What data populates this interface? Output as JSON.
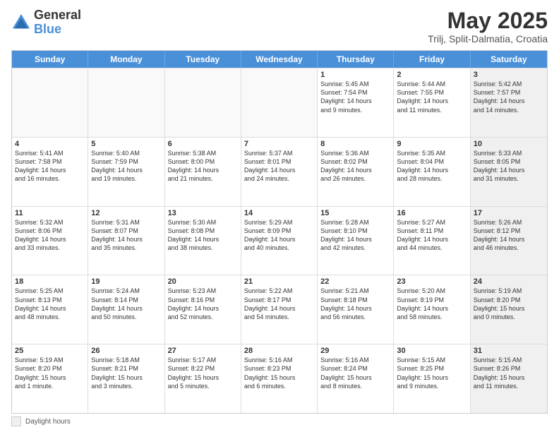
{
  "logo": {
    "general": "General",
    "blue": "Blue"
  },
  "title": "May 2025",
  "subtitle": "Trilj, Split-Dalmatia, Croatia",
  "weekdays": [
    "Sunday",
    "Monday",
    "Tuesday",
    "Wednesday",
    "Thursday",
    "Friday",
    "Saturday"
  ],
  "legend_label": "Daylight hours",
  "weeks": [
    [
      {
        "day": "",
        "text": "",
        "empty": true
      },
      {
        "day": "",
        "text": "",
        "empty": true
      },
      {
        "day": "",
        "text": "",
        "empty": true
      },
      {
        "day": "",
        "text": "",
        "empty": true
      },
      {
        "day": "1",
        "text": "Sunrise: 5:45 AM\nSunset: 7:54 PM\nDaylight: 14 hours\nand 9 minutes."
      },
      {
        "day": "2",
        "text": "Sunrise: 5:44 AM\nSunset: 7:55 PM\nDaylight: 14 hours\nand 11 minutes."
      },
      {
        "day": "3",
        "text": "Sunrise: 5:42 AM\nSunset: 7:57 PM\nDaylight: 14 hours\nand 14 minutes.",
        "shaded": true
      }
    ],
    [
      {
        "day": "4",
        "text": "Sunrise: 5:41 AM\nSunset: 7:58 PM\nDaylight: 14 hours\nand 16 minutes."
      },
      {
        "day": "5",
        "text": "Sunrise: 5:40 AM\nSunset: 7:59 PM\nDaylight: 14 hours\nand 19 minutes."
      },
      {
        "day": "6",
        "text": "Sunrise: 5:38 AM\nSunset: 8:00 PM\nDaylight: 14 hours\nand 21 minutes."
      },
      {
        "day": "7",
        "text": "Sunrise: 5:37 AM\nSunset: 8:01 PM\nDaylight: 14 hours\nand 24 minutes."
      },
      {
        "day": "8",
        "text": "Sunrise: 5:36 AM\nSunset: 8:02 PM\nDaylight: 14 hours\nand 26 minutes."
      },
      {
        "day": "9",
        "text": "Sunrise: 5:35 AM\nSunset: 8:04 PM\nDaylight: 14 hours\nand 28 minutes."
      },
      {
        "day": "10",
        "text": "Sunrise: 5:33 AM\nSunset: 8:05 PM\nDaylight: 14 hours\nand 31 minutes.",
        "shaded": true
      }
    ],
    [
      {
        "day": "11",
        "text": "Sunrise: 5:32 AM\nSunset: 8:06 PM\nDaylight: 14 hours\nand 33 minutes."
      },
      {
        "day": "12",
        "text": "Sunrise: 5:31 AM\nSunset: 8:07 PM\nDaylight: 14 hours\nand 35 minutes."
      },
      {
        "day": "13",
        "text": "Sunrise: 5:30 AM\nSunset: 8:08 PM\nDaylight: 14 hours\nand 38 minutes."
      },
      {
        "day": "14",
        "text": "Sunrise: 5:29 AM\nSunset: 8:09 PM\nDaylight: 14 hours\nand 40 minutes."
      },
      {
        "day": "15",
        "text": "Sunrise: 5:28 AM\nSunset: 8:10 PM\nDaylight: 14 hours\nand 42 minutes."
      },
      {
        "day": "16",
        "text": "Sunrise: 5:27 AM\nSunset: 8:11 PM\nDaylight: 14 hours\nand 44 minutes."
      },
      {
        "day": "17",
        "text": "Sunrise: 5:26 AM\nSunset: 8:12 PM\nDaylight: 14 hours\nand 46 minutes.",
        "shaded": true
      }
    ],
    [
      {
        "day": "18",
        "text": "Sunrise: 5:25 AM\nSunset: 8:13 PM\nDaylight: 14 hours\nand 48 minutes."
      },
      {
        "day": "19",
        "text": "Sunrise: 5:24 AM\nSunset: 8:14 PM\nDaylight: 14 hours\nand 50 minutes."
      },
      {
        "day": "20",
        "text": "Sunrise: 5:23 AM\nSunset: 8:16 PM\nDaylight: 14 hours\nand 52 minutes."
      },
      {
        "day": "21",
        "text": "Sunrise: 5:22 AM\nSunset: 8:17 PM\nDaylight: 14 hours\nand 54 minutes."
      },
      {
        "day": "22",
        "text": "Sunrise: 5:21 AM\nSunset: 8:18 PM\nDaylight: 14 hours\nand 56 minutes."
      },
      {
        "day": "23",
        "text": "Sunrise: 5:20 AM\nSunset: 8:19 PM\nDaylight: 14 hours\nand 58 minutes."
      },
      {
        "day": "24",
        "text": "Sunrise: 5:19 AM\nSunset: 8:20 PM\nDaylight: 15 hours\nand 0 minutes.",
        "shaded": true
      }
    ],
    [
      {
        "day": "25",
        "text": "Sunrise: 5:19 AM\nSunset: 8:20 PM\nDaylight: 15 hours\nand 1 minute."
      },
      {
        "day": "26",
        "text": "Sunrise: 5:18 AM\nSunset: 8:21 PM\nDaylight: 15 hours\nand 3 minutes."
      },
      {
        "day": "27",
        "text": "Sunrise: 5:17 AM\nSunset: 8:22 PM\nDaylight: 15 hours\nand 5 minutes."
      },
      {
        "day": "28",
        "text": "Sunrise: 5:16 AM\nSunset: 8:23 PM\nDaylight: 15 hours\nand 6 minutes."
      },
      {
        "day": "29",
        "text": "Sunrise: 5:16 AM\nSunset: 8:24 PM\nDaylight: 15 hours\nand 8 minutes."
      },
      {
        "day": "30",
        "text": "Sunrise: 5:15 AM\nSunset: 8:25 PM\nDaylight: 15 hours\nand 9 minutes."
      },
      {
        "day": "31",
        "text": "Sunrise: 5:15 AM\nSunset: 8:26 PM\nDaylight: 15 hours\nand 11 minutes.",
        "shaded": true
      }
    ]
  ]
}
